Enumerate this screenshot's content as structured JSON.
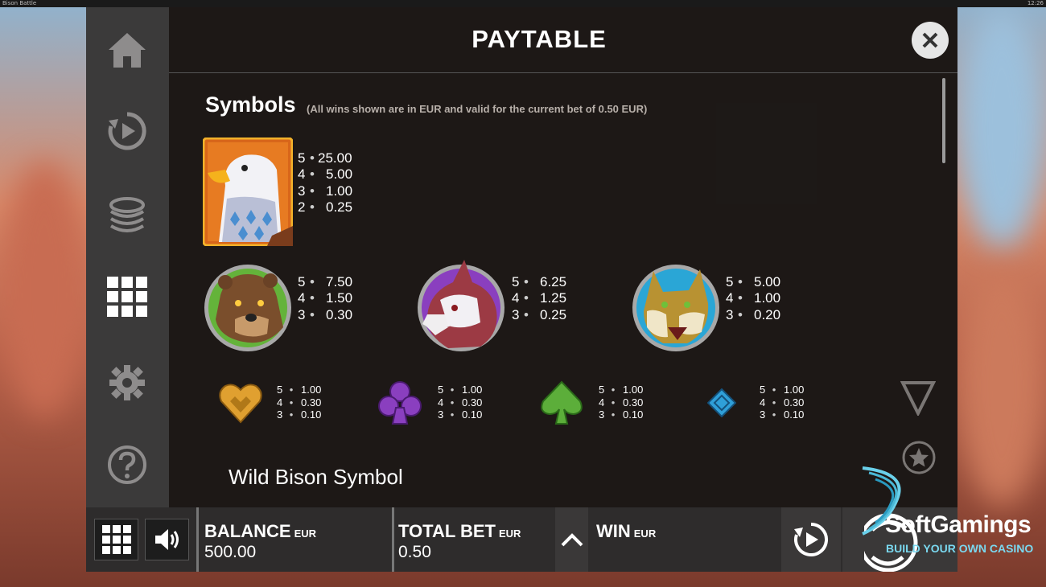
{
  "window": {
    "title": "Bison Battle",
    "time": "12:26"
  },
  "paytable": {
    "title": "PAYTABLE",
    "heading": "Symbols",
    "note": "(All wins shown are in EUR and valid for the current bet of 0.50 EUR)",
    "symbols": [
      {
        "name": "eagle",
        "pays": [
          {
            "count": "5",
            "value": "25.00"
          },
          {
            "count": "4",
            "value": "5.00"
          },
          {
            "count": "3",
            "value": "1.00"
          },
          {
            "count": "2",
            "value": "0.25"
          }
        ]
      },
      {
        "name": "bear",
        "pays": [
          {
            "count": "5",
            "value": "7.50"
          },
          {
            "count": "4",
            "value": "1.50"
          },
          {
            "count": "3",
            "value": "0.30"
          }
        ]
      },
      {
        "name": "wolf",
        "pays": [
          {
            "count": "5",
            "value": "6.25"
          },
          {
            "count": "4",
            "value": "1.25"
          },
          {
            "count": "3",
            "value": "0.25"
          }
        ]
      },
      {
        "name": "lynx",
        "pays": [
          {
            "count": "5",
            "value": "5.00"
          },
          {
            "count": "4",
            "value": "1.00"
          },
          {
            "count": "3",
            "value": "0.20"
          }
        ]
      },
      {
        "name": "heart",
        "pays": [
          {
            "count": "5",
            "value": "1.00"
          },
          {
            "count": "4",
            "value": "0.30"
          },
          {
            "count": "3",
            "value": "0.10"
          }
        ]
      },
      {
        "name": "club",
        "pays": [
          {
            "count": "5",
            "value": "1.00"
          },
          {
            "count": "4",
            "value": "0.30"
          },
          {
            "count": "3",
            "value": "0.10"
          }
        ]
      },
      {
        "name": "spade",
        "pays": [
          {
            "count": "5",
            "value": "1.00"
          },
          {
            "count": "4",
            "value": "0.30"
          },
          {
            "count": "3",
            "value": "0.10"
          }
        ]
      },
      {
        "name": "diamond",
        "pays": [
          {
            "count": "5",
            "value": "1.00"
          },
          {
            "count": "4",
            "value": "0.30"
          },
          {
            "count": "3",
            "value": "0.10"
          }
        ]
      }
    ],
    "wild_heading": "Wild Bison Symbol"
  },
  "side_menu": {
    "items": [
      "home-icon",
      "autoplay-icon",
      "coins-icon",
      "paytable-grid-icon",
      "settings-gear-icon",
      "help-icon"
    ]
  },
  "bottom_bar": {
    "balance_label": "BALANCE",
    "balance_currency": "EUR",
    "balance_value": "500.00",
    "bet_label": "TOTAL BET",
    "bet_currency": "EUR",
    "bet_value": "0.50",
    "win_label": "WIN",
    "win_currency": "EUR"
  },
  "watermark": {
    "brand": "SoftGamings",
    "tagline": "BUILD YOUR OWN CASINO"
  },
  "colors": {
    "panel": "#1c1816",
    "sidebar": "#3b3a3a",
    "accent_blue": "#7ad8ef",
    "heart": "#e0a030",
    "club": "#8a3fbf",
    "spade": "#5cae3a",
    "diamond": "#2f9fd8"
  }
}
